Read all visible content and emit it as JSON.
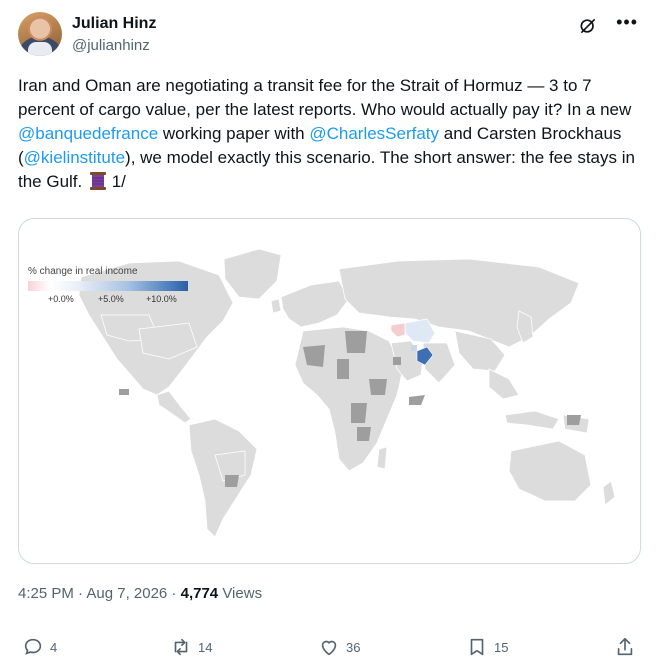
{
  "author": {
    "name": "Julian Hinz",
    "handle": "@julianhinz"
  },
  "tweet": {
    "p1": "Iran and Oman are negotiating a transit fee for the Strait of Hormuz — 3 to 7 percent of cargo value, per the latest reports. Who would actually pay it? In a new ",
    "m1": "@banquedefrance",
    "p2": " working paper with ",
    "m2": "@CharlesSerfaty",
    "p3": " and Carsten Brockhaus (",
    "m3": "@kielinstitute",
    "p4": "), we model exactly this scenario. The short answer: the fee stays in the Gulf. ",
    "p5": " 1/"
  },
  "map": {
    "legend_title": "% change in real income",
    "ticks": [
      "+0.0%",
      "+5.0%",
      "+10.0%"
    ],
    "colors": {
      "land": "#dcdcdc",
      "border": "#ffffff",
      "gray_region": "#9e9e9e",
      "iran": "#dfe8f5",
      "oman": "#3f6fb3",
      "negative": "#f4cdd0"
    }
  },
  "meta": {
    "time": "4:25 PM · Aug 7, 2026 · ",
    "views_count": "4,774",
    "views_label": " Views"
  },
  "actions": {
    "replies": "4",
    "reposts": "14",
    "likes": "36",
    "bookmarks": "15"
  },
  "colors": {
    "accent": "#1d9bf0",
    "text": "#0f1419",
    "secondary": "#536471"
  }
}
